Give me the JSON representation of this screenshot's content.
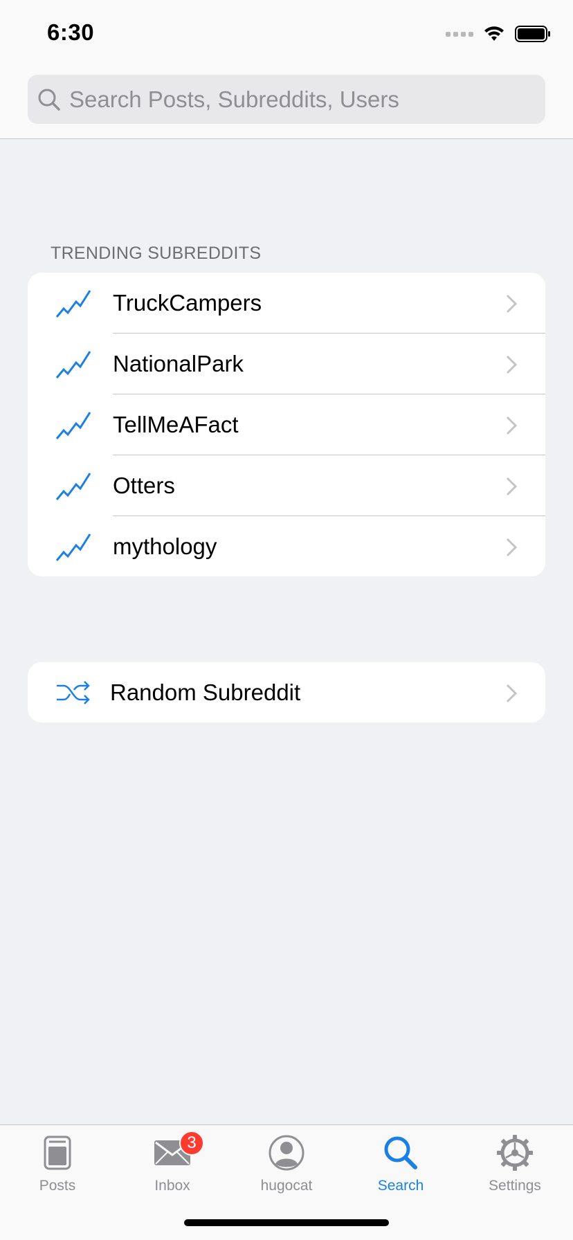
{
  "status_bar": {
    "time": "6:30"
  },
  "search": {
    "placeholder": "Search Posts, Subreddits, Users",
    "value": ""
  },
  "trending": {
    "header": "TRENDING SUBREDDITS",
    "items": [
      {
        "label": "TruckCampers",
        "icon": "trending-up-icon"
      },
      {
        "label": "NationalPark",
        "icon": "trending-up-icon"
      },
      {
        "label": "TellMeAFact",
        "icon": "trending-up-icon"
      },
      {
        "label": "Otters",
        "icon": "trending-up-icon"
      },
      {
        "label": "mythology",
        "icon": "trending-up-icon"
      }
    ]
  },
  "random": {
    "label": "Random Subreddit",
    "icon": "shuffle-icon"
  },
  "tab_bar": {
    "tabs": [
      {
        "label": "Posts",
        "icon": "posts-icon"
      },
      {
        "label": "Inbox",
        "icon": "mail-icon",
        "badge": "3"
      },
      {
        "label": "hugocat",
        "icon": "profile-icon"
      },
      {
        "label": "Search",
        "icon": "search-icon",
        "active": true
      },
      {
        "label": "Settings",
        "icon": "gear-icon"
      }
    ]
  },
  "colors": {
    "accent": "#1a80e5",
    "background": "#f0f1f5",
    "badge": "#ff3b30",
    "inactive": "#8e8e93"
  }
}
